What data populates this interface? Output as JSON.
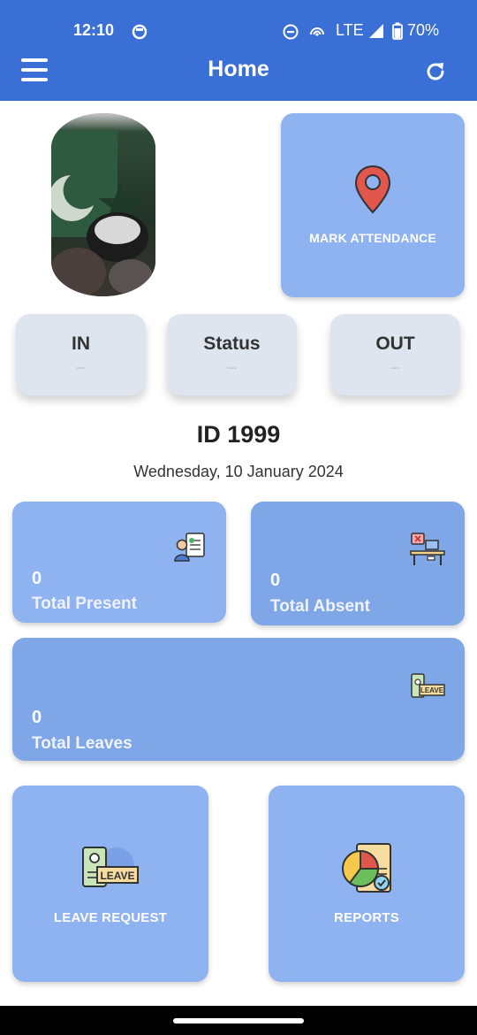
{
  "status_bar": {
    "time": "12:10",
    "network": "LTE",
    "battery": "70%"
  },
  "app_bar": {
    "title": "Home"
  },
  "attendance_button": {
    "label": "MARK ATTENDANCE"
  },
  "chips": [
    {
      "title": "IN",
      "value": "---"
    },
    {
      "title": "Status",
      "value": "---"
    },
    {
      "title": "OUT",
      "value": "---"
    }
  ],
  "user": {
    "id_text": "ID 1999"
  },
  "date_text": "Wednesday, 10 January 2024",
  "stats": {
    "present": {
      "count": "0",
      "label": "Total Present"
    },
    "absent": {
      "count": "0",
      "label": "Total Absent"
    },
    "leaves": {
      "count": "0",
      "label": "Total Leaves"
    }
  },
  "actions": {
    "leave_request": {
      "label": "LEAVE REQUEST",
      "badge": "LEAVE"
    },
    "reports": {
      "label": "REPORTS"
    }
  },
  "colors": {
    "app_bar": "#3a6fd6",
    "card": "#8fb2f0",
    "chip": "#dfe5ef"
  }
}
